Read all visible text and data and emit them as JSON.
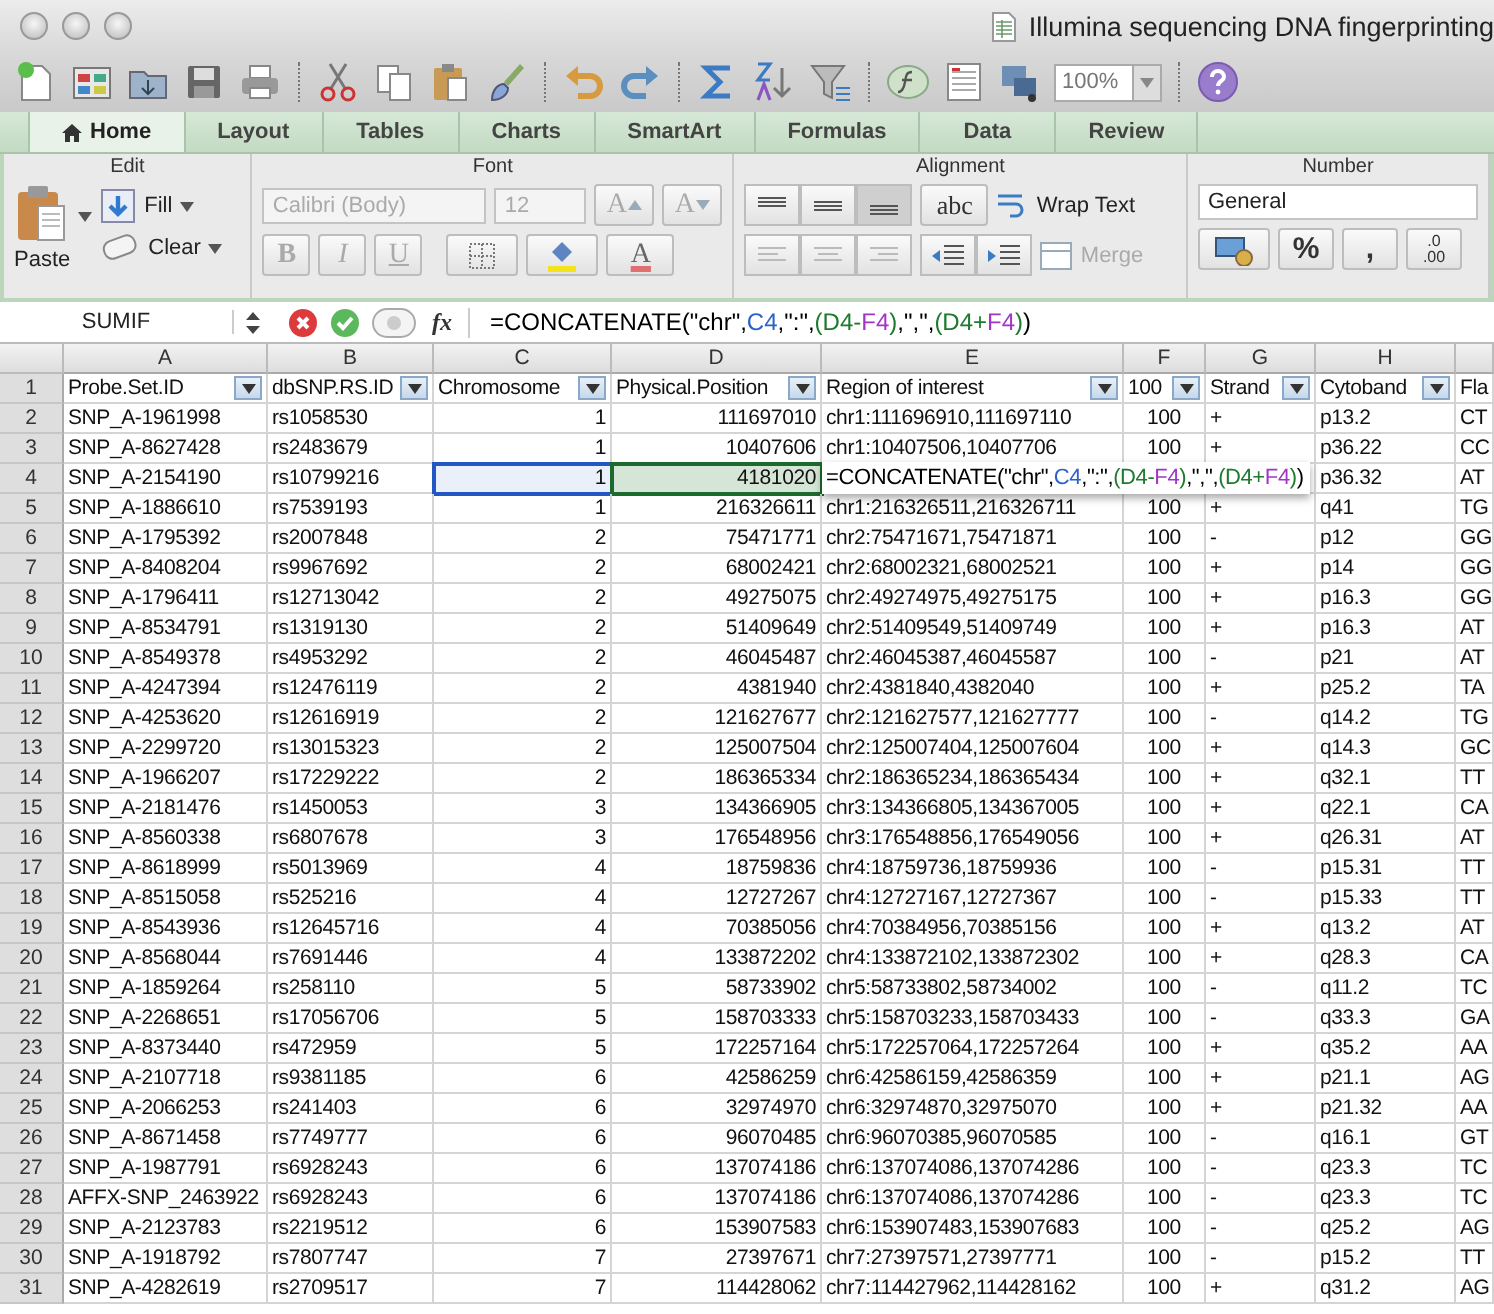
{
  "window": {
    "title": "Illumina sequencing DNA fingerprinting"
  },
  "toolbar": {
    "zoom": "100%"
  },
  "tabs": [
    {
      "label": "Home",
      "selected": true
    },
    {
      "label": "Layout",
      "selected": false
    },
    {
      "label": "Tables",
      "selected": false
    },
    {
      "label": "Charts",
      "selected": false
    },
    {
      "label": "SmartArt",
      "selected": false
    },
    {
      "label": "Formulas",
      "selected": false
    },
    {
      "label": "Data",
      "selected": false
    },
    {
      "label": "Review",
      "selected": false
    }
  ],
  "ribbon": {
    "groups": [
      "Edit",
      "Font",
      "Alignment",
      "Number"
    ],
    "paste": "Paste",
    "fill": "Fill",
    "clear": "Clear",
    "font_name": {
      "value": "Calibri (Body)",
      "disabled": true
    },
    "font_size": {
      "value": "12",
      "disabled": true
    },
    "grow_font": {
      "label": "A",
      "disabled": true
    },
    "shrink_font": {
      "label": "A",
      "disabled": true
    },
    "bold": {
      "label": "B",
      "disabled": true
    },
    "italic": {
      "label": "I",
      "disabled": true
    },
    "underline": {
      "label": "U",
      "disabled": true
    },
    "font_color": {
      "label": "A"
    },
    "orientation": "abc",
    "wrap_text": "Wrap Text",
    "merge": {
      "label": "Merge",
      "disabled": true
    },
    "number_format": "General",
    "percent": "%",
    "comma": ",",
    "decimal": {
      "top": ".0",
      "bottom": ".00"
    }
  },
  "formula_bar": {
    "name_box": "SUMIF",
    "fx": "fx",
    "formula": [
      {
        "text": "=CONCATENATE(\"chr\",",
        "color": "#000000"
      },
      {
        "text": "C4",
        "color": "#2a62c9"
      },
      {
        "text": ",\":\",",
        "color": "#000000"
      },
      {
        "text": "(D4-",
        "color": "#1d7a2e"
      },
      {
        "text": "F4",
        "color": "#a035c9"
      },
      {
        "text": ")",
        "color": "#1d7a2e"
      },
      {
        "text": ",\",\",",
        "color": "#000000"
      },
      {
        "text": "(D4+",
        "color": "#1d7a2e"
      },
      {
        "text": "F4",
        "color": "#a035c9"
      },
      {
        "text": ")",
        "color": "#1d7a2e"
      },
      {
        "text": ")",
        "color": "#000000"
      }
    ]
  },
  "columns": [
    "A",
    "B",
    "C",
    "D",
    "E",
    "F",
    "G",
    "H"
  ],
  "header_row": {
    "number": "1",
    "cells": [
      {
        "text": "Probe.Set.ID",
        "filter": true
      },
      {
        "text": "dbSNP.RS.ID",
        "filter": true
      },
      {
        "text": "Chromosome",
        "filter": true
      },
      {
        "text": "Physical.Position",
        "filter": true
      },
      {
        "text": "Region of interest",
        "filter": true
      },
      {
        "text": "100",
        "filter": true
      },
      {
        "text": "Strand",
        "filter": true
      },
      {
        "text": "Cytoband",
        "filter": true
      },
      {
        "text": "Fla",
        "filter": false
      }
    ]
  },
  "rows": [
    {
      "number": "2",
      "cells": [
        "SNP_A-1961998",
        "rs1058530",
        "1",
        "111697010",
        "chr1:111696910,111697110",
        "100",
        "+",
        "p13.2",
        "CT"
      ]
    },
    {
      "number": "3",
      "cells": [
        "SNP_A-8627428",
        "rs2483679",
        "1",
        "10407606",
        "chr1:10407506,10407706",
        "100",
        "+",
        "p36.22",
        "CC"
      ]
    },
    {
      "number": "4",
      "cells": [
        "SNP_A-2154190",
        "rs10799216",
        "1",
        "4181020"
      ],
      "selected": [
        false,
        false,
        true,
        false
      ],
      "referenced": [
        false,
        false,
        false,
        true
      ],
      "editor": [
        {
          "text": "=CONCATENATE(\"chr\",",
          "color": "#000000"
        },
        {
          "text": "C4",
          "color": "#2a62c9"
        },
        {
          "text": ",\":\",",
          "color": "#000000"
        },
        {
          "text": "(D4-",
          "color": "#1d7a2e"
        },
        {
          "text": "F4",
          "color": "#a035c9"
        },
        {
          "text": ")",
          "color": "#1d7a2e"
        },
        {
          "text": ",\",\",",
          "color": "#000000"
        },
        {
          "text": "(D4+",
          "color": "#1d7a2e"
        },
        {
          "text": "F4",
          "color": "#a035c9"
        },
        {
          "text": ")",
          "color": "#1d7a2e"
        },
        {
          "text": ")",
          "color": "#000000"
        }
      ],
      "tail": [
        "p36.32",
        "AT"
      ]
    },
    {
      "number": "5",
      "cells": [
        "SNP_A-1886610",
        "rs7539193",
        "1",
        "216326611",
        "chr1:216326511,216326711",
        "100",
        "+",
        "q41",
        "TG"
      ]
    },
    {
      "number": "6",
      "cells": [
        "SNP_A-1795392",
        "rs2007848",
        "2",
        "75471771",
        "chr2:75471671,75471871",
        "100",
        "-",
        "p12",
        "GG"
      ]
    },
    {
      "number": "7",
      "cells": [
        "SNP_A-8408204",
        "rs9967692",
        "2",
        "68002421",
        "chr2:68002321,68002521",
        "100",
        "+",
        "p14",
        "GG"
      ]
    },
    {
      "number": "8",
      "cells": [
        "SNP_A-1796411",
        "rs12713042",
        "2",
        "49275075",
        "chr2:49274975,49275175",
        "100",
        "+",
        "p16.3",
        "GG"
      ]
    },
    {
      "number": "9",
      "cells": [
        "SNP_A-8534791",
        "rs1319130",
        "2",
        "51409649",
        "chr2:51409549,51409749",
        "100",
        "+",
        "p16.3",
        "AT"
      ]
    },
    {
      "number": "10",
      "cells": [
        "SNP_A-8549378",
        "rs4953292",
        "2",
        "46045487",
        "chr2:46045387,46045587",
        "100",
        "-",
        "p21",
        "AT"
      ]
    },
    {
      "number": "11",
      "cells": [
        "SNP_A-4247394",
        "rs12476119",
        "2",
        "4381940",
        "chr2:4381840,4382040",
        "100",
        "+",
        "p25.2",
        "TA"
      ]
    },
    {
      "number": "12",
      "cells": [
        "SNP_A-4253620",
        "rs12616919",
        "2",
        "121627677",
        "chr2:121627577,121627777",
        "100",
        "-",
        "q14.2",
        "TG"
      ]
    },
    {
      "number": "13",
      "cells": [
        "SNP_A-2299720",
        "rs13015323",
        "2",
        "125007504",
        "chr2:125007404,125007604",
        "100",
        "+",
        "q14.3",
        "GC"
      ]
    },
    {
      "number": "14",
      "cells": [
        "SNP_A-1966207",
        "rs17229222",
        "2",
        "186365334",
        "chr2:186365234,186365434",
        "100",
        "+",
        "q32.1",
        "TT"
      ]
    },
    {
      "number": "15",
      "cells": [
        "SNP_A-2181476",
        "rs1450053",
        "3",
        "134366905",
        "chr3:134366805,134367005",
        "100",
        "+",
        "q22.1",
        "CA"
      ]
    },
    {
      "number": "16",
      "cells": [
        "SNP_A-8560338",
        "rs6807678",
        "3",
        "176548956",
        "chr3:176548856,176549056",
        "100",
        "+",
        "q26.31",
        "AT"
      ]
    },
    {
      "number": "17",
      "cells": [
        "SNP_A-8618999",
        "rs5013969",
        "4",
        "18759836",
        "chr4:18759736,18759936",
        "100",
        "-",
        "p15.31",
        "TT"
      ]
    },
    {
      "number": "18",
      "cells": [
        "SNP_A-8515058",
        "rs525216",
        "4",
        "12727267",
        "chr4:12727167,12727367",
        "100",
        "-",
        "p15.33",
        "TT"
      ]
    },
    {
      "number": "19",
      "cells": [
        "SNP_A-8543936",
        "rs12645716",
        "4",
        "70385056",
        "chr4:70384956,70385156",
        "100",
        "+",
        "q13.2",
        "AT"
      ]
    },
    {
      "number": "20",
      "cells": [
        "SNP_A-8568044",
        "rs7691446",
        "4",
        "133872202",
        "chr4:133872102,133872302",
        "100",
        "+",
        "q28.3",
        "CA"
      ]
    },
    {
      "number": "21",
      "cells": [
        "SNP_A-1859264",
        "rs258110",
        "5",
        "58733902",
        "chr5:58733802,58734002",
        "100",
        "-",
        "q11.2",
        "TC"
      ]
    },
    {
      "number": "22",
      "cells": [
        "SNP_A-2268651",
        "rs17056706",
        "5",
        "158703333",
        "chr5:158703233,158703433",
        "100",
        "-",
        "q33.3",
        "GA"
      ]
    },
    {
      "number": "23",
      "cells": [
        "SNP_A-8373440",
        "rs472959",
        "5",
        "172257164",
        "chr5:172257064,172257264",
        "100",
        "+",
        "q35.2",
        "AA"
      ]
    },
    {
      "number": "24",
      "cells": [
        "SNP_A-2107718",
        "rs9381185",
        "6",
        "42586259",
        "chr6:42586159,42586359",
        "100",
        "+",
        "p21.1",
        "AG"
      ]
    },
    {
      "number": "25",
      "cells": [
        "SNP_A-2066253",
        "rs241403",
        "6",
        "32974970",
        "chr6:32974870,32975070",
        "100",
        "+",
        "p21.32",
        "AA"
      ]
    },
    {
      "number": "26",
      "cells": [
        "SNP_A-8671458",
        "rs7749777",
        "6",
        "96070485",
        "chr6:96070385,96070585",
        "100",
        "-",
        "q16.1",
        "GT"
      ]
    },
    {
      "number": "27",
      "cells": [
        "SNP_A-1987791",
        "rs6928243",
        "6",
        "137074186",
        "chr6:137074086,137074286",
        "100",
        "-",
        "q23.3",
        "TC"
      ]
    },
    {
      "number": "28",
      "cells": [
        "AFFX-SNP_2463922",
        "rs6928243",
        "6",
        "137074186",
        "chr6:137074086,137074286",
        "100",
        "-",
        "q23.3",
        "TC"
      ]
    },
    {
      "number": "29",
      "cells": [
        "SNP_A-2123783",
        "rs2219512",
        "6",
        "153907583",
        "chr6:153907483,153907683",
        "100",
        "-",
        "q25.2",
        "AG"
      ]
    },
    {
      "number": "30",
      "cells": [
        "SNP_A-1918792",
        "rs7807747",
        "7",
        "27397671",
        "chr7:27397571,27397771",
        "100",
        "-",
        "p15.2",
        "TT"
      ]
    },
    {
      "number": "31",
      "cells": [
        "SNP_A-4282619",
        "rs2709517",
        "7",
        "114428062",
        "chr7:114427962,114428162",
        "100",
        "+",
        "q31.2",
        "AG"
      ]
    }
  ]
}
